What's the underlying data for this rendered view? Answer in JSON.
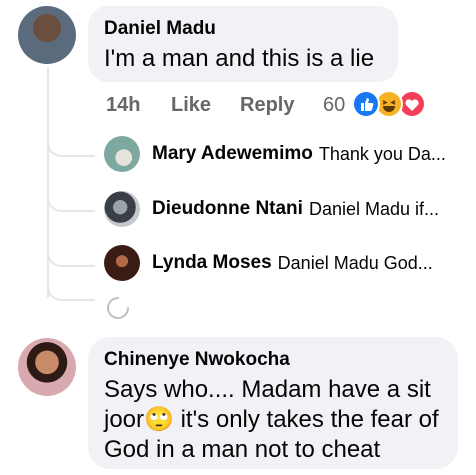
{
  "comment1": {
    "author": "Daniel Madu",
    "text": "I'm a man and this is a lie",
    "time": "14h",
    "like_label": "Like",
    "reply_label": "Reply",
    "reaction_count": "60",
    "reaction_icons": [
      "like-icon",
      "haha-icon",
      "love-icon"
    ],
    "replies": [
      {
        "name": "Mary Adewemimo",
        "snippet": "Thank you Da..."
      },
      {
        "name": "Dieudonne Ntani",
        "snippet": "Daniel Madu if..."
      },
      {
        "name": "Lynda Moses",
        "snippet": "Daniel Madu God..."
      }
    ]
  },
  "comment2": {
    "author": "Chinenye Nwokocha",
    "line1": "Says who.... Madam have a sit",
    "line2_a": "joor",
    "line2_emoji": "🙄",
    "line2_b": " it's only takes the fear of",
    "line3": "God in a man not to cheat"
  },
  "colors": {
    "bubble": "#f0f2f5",
    "meta_text": "#65676b",
    "thread_line": "#e4e6eb",
    "like_blue": "#1877f2",
    "love_red": "#f33e58",
    "haha_yellow": "#f7b125"
  }
}
